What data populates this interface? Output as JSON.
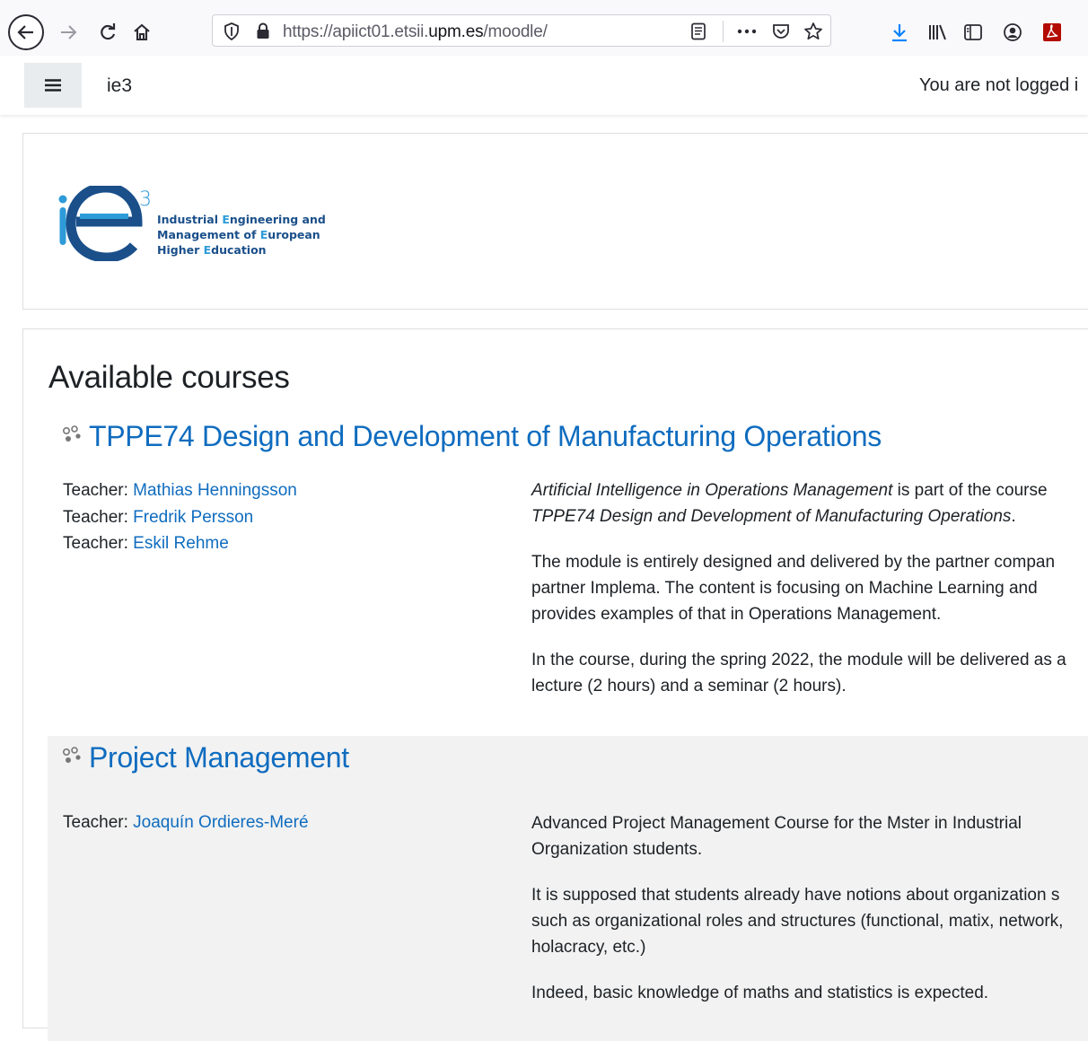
{
  "browser": {
    "url_prefix": "https://apiict01.etsii.",
    "url_domain": "upm.es",
    "url_suffix": "/moodle/"
  },
  "navbar": {
    "site_name": "ie3",
    "login_info": "You are not logged i"
  },
  "logo": {
    "mark_text": "3",
    "lines": [
      {
        "a": "Industrial ",
        "b": "E",
        "c": "ngineering and"
      },
      {
        "a": "Management of ",
        "b": "E",
        "c": "uropean"
      },
      {
        "a": "Higher ",
        "b": "E",
        "c": "ducation"
      }
    ]
  },
  "main": {
    "section_title": "Available courses",
    "courses": [
      {
        "name": "TPPE74 Design and Development of Manufacturing Operations",
        "teacher_role": "Teacher: ",
        "teachers": [
          "Mathias Henningsson",
          "Fredrik Persson",
          "Eskil Rehme"
        ],
        "summary": {
          "p1_i1": "Artificial Intelligence in Operations Management",
          "p1_t1": " is part of the course",
          "p1_i2": "TPPE74 Design and Development of Manufacturing Operations",
          "p1_t2": ".",
          "p2_l1": "The module is entirely designed and delivered by the partner compan",
          "p2_l2": "partner Implema. The content is focusing on Machine Learning and",
          "p2_l3": "provides examples of that in Operations Management.",
          "p3_l1": "In the course, during the spring 2022, the module will be delivered as a",
          "p3_l2": "lecture (2 hours) and a seminar (2 hours)."
        }
      },
      {
        "name": "Project Management",
        "teacher_role": "Teacher: ",
        "teachers": [
          "Joaquín Ordieres-Meré"
        ],
        "summary": {
          "p1_l1": "Advanced Project Management Course for the Mster in Industrial",
          "p1_l2": "Organization students.",
          "p2_l1": "It is supposed that students already have notions about organization s",
          "p2_l2": "such as organizational roles and structures (functional, matix, network,",
          "p2_l3": "holacracy, etc.)",
          "p3_l1": "Indeed, basic knowledge of maths and statistics is expected."
        }
      }
    ]
  },
  "colors": {
    "link": "#0f6cbf",
    "logo_blue": "#1a4f8a",
    "logo_light_blue": "#2d9bd8"
  }
}
